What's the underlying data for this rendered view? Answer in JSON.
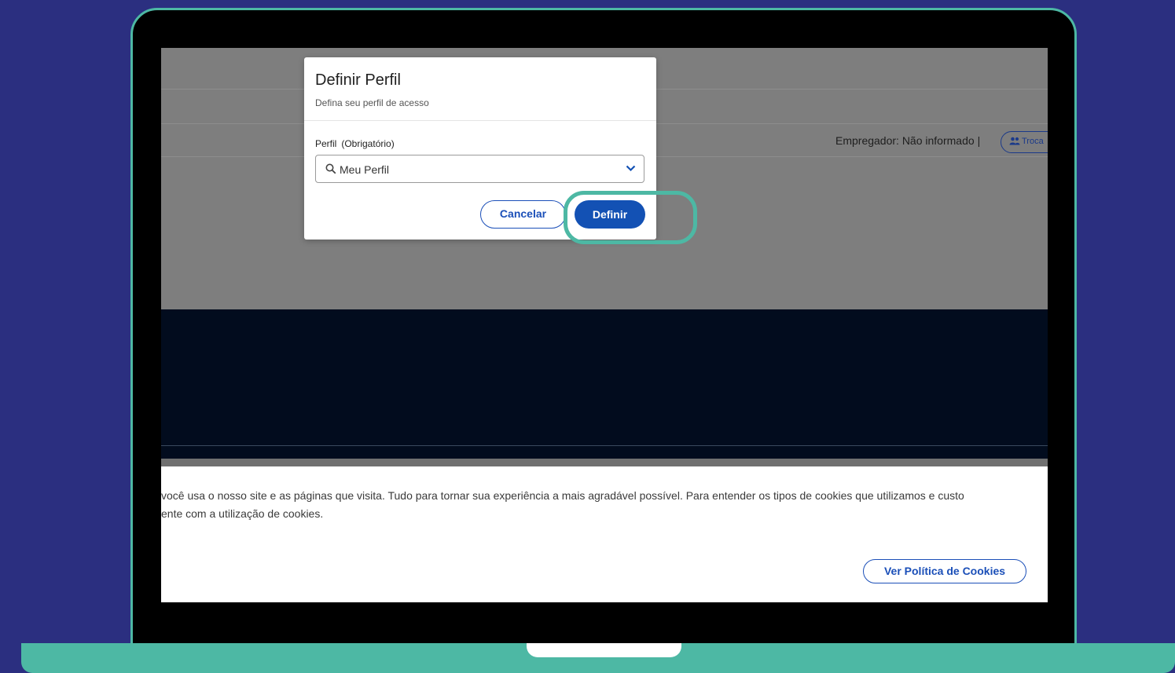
{
  "colors": {
    "background": "#2b2f80",
    "frame_accent": "#4db8a4",
    "primary_blue": "#1351b4",
    "overlay_gray": "#7e7e7e",
    "dark_band": "#020c1e"
  },
  "header": {
    "employer_label": "Empregador: Não informado",
    "employer_separator": "|",
    "switch_button_icon": "users-icon",
    "switch_button_label": "Troca"
  },
  "modal": {
    "title": "Definir Perfil",
    "subtitle": "Defina seu perfil de acesso",
    "field_label": "Perfil",
    "field_required": "(Obrigatório)",
    "field_value": "Meu Perfil",
    "search_icon": "search-icon",
    "dropdown_icon": "chevron-down-icon",
    "cancel_label": "Cancelar",
    "define_label": "Definir"
  },
  "cookie_banner": {
    "line1": "você usa o nosso site e as páginas que visita. Tudo para tornar sua experiência a mais agradável possível. Para entender os tipos de cookies que utilizamos e custo",
    "line2": "ente com a utilização de cookies.",
    "policy_button": "Ver Política de Cookies"
  }
}
